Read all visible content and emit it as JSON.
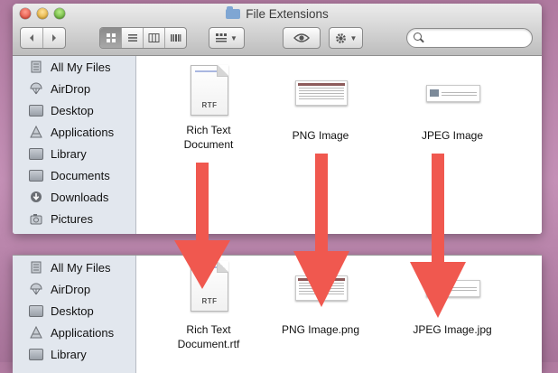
{
  "window": {
    "title": "File Extensions"
  },
  "colors": {
    "arrow": "#f0584f",
    "sidebar_bg": "#e2e7ee"
  },
  "toolbar": {
    "back_icon": "back-arrow-icon",
    "forward_icon": "forward-arrow-icon",
    "view_modes": [
      "icon-view-icon",
      "list-view-icon",
      "column-view-icon",
      "cover-flow-icon"
    ],
    "active_view": "icon-view",
    "arrange_icon": "arrange-grid-icon",
    "quicklook_icon": "eye-icon",
    "action_icon": "gear-icon",
    "search": {
      "placeholder": "",
      "value": ""
    }
  },
  "sidebar": {
    "items": [
      {
        "label": "All My Files",
        "icon": "all-my-files-icon"
      },
      {
        "label": "AirDrop",
        "icon": "airdrop-icon"
      },
      {
        "label": "Desktop",
        "icon": "desktop-icon"
      },
      {
        "label": "Applications",
        "icon": "applications-icon"
      },
      {
        "label": "Library",
        "icon": "folder-icon"
      },
      {
        "label": "Documents",
        "icon": "documents-icon"
      },
      {
        "label": "Downloads",
        "icon": "downloads-icon"
      },
      {
        "label": "Pictures",
        "icon": "pictures-icon"
      }
    ]
  },
  "before": {
    "files": [
      {
        "line1": "Rich Text",
        "line2": "Document",
        "type": "RTF"
      },
      {
        "line1": "PNG Image",
        "line2": "",
        "type": "png"
      },
      {
        "line1": "JPEG Image",
        "line2": "",
        "type": "jpg"
      }
    ]
  },
  "after": {
    "files": [
      {
        "line1": "Rich Text",
        "line2": "Document.rtf",
        "type": "RTF"
      },
      {
        "line1": "PNG Image.png",
        "line2": "",
        "type": "png"
      },
      {
        "line1": "JPEG Image.jpg",
        "line2": "",
        "type": "jpg"
      }
    ]
  },
  "rtf_tag": "RTF"
}
